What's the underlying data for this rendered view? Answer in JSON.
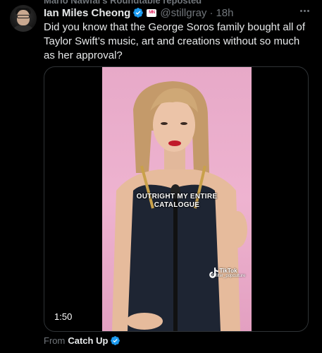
{
  "repost": {
    "text": "Mario Nawfal's Roundtable reposted"
  },
  "tweet": {
    "author_name": "Ian Miles Cheong",
    "handle": "@stillgray",
    "separator": "·",
    "time": "18h",
    "affiliate_badge": "MN",
    "text": "Did you know that the George Soros family bought all of Taylor Swift’s music, art and creations without so much as her approval?"
  },
  "media": {
    "caption_line1": "OUTRIGHT MY ENTIRE",
    "caption_line2": "CATALOGUE",
    "watermark_label": "TikTok",
    "watermark_user": "@filter_popculture",
    "duration": "1:50"
  },
  "from": {
    "label": "From",
    "source": "Catch Up"
  },
  "colors": {
    "background": "#000000",
    "text_primary": "#e7e9ea",
    "text_secondary": "#71767b",
    "verified_blue": "#1d9bf0",
    "border": "#2f3336",
    "video_bg_pink": "#e7a9c8"
  },
  "icons": [
    "verified-icon",
    "more-icon",
    "tiktok-icon"
  ]
}
